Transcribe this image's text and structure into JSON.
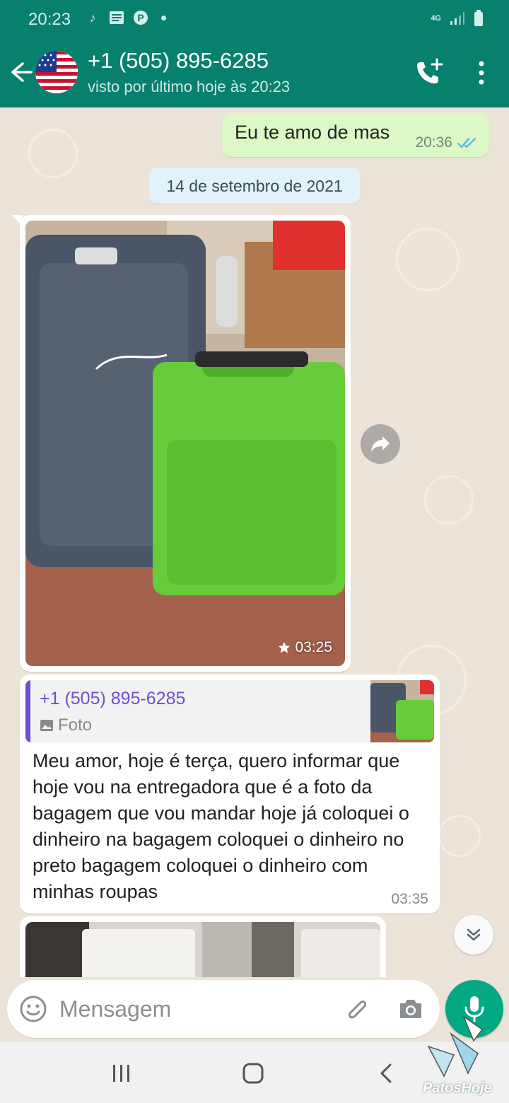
{
  "status_bar": {
    "time": "20:23",
    "network": "4G",
    "icons": [
      "tiktok-icon",
      "news-app-icon",
      "pinterest-icon",
      "notification-dot-icon",
      "signal-icon",
      "battery-icon"
    ]
  },
  "header": {
    "contact_name": "+1 (505) 895-6285",
    "contact_status": "visto por último hoje às 20:23",
    "avatar": "us-flag-avatar"
  },
  "messages": {
    "outgoing": {
      "text": "Eu te amo de mas",
      "time": "20:36",
      "status": "read"
    },
    "date_separator": "14 de setembro de 2021",
    "photo": {
      "time": "03:25",
      "starred": true,
      "description_icon": "photo-suitcases"
    },
    "reply": {
      "quoted_sender": "+1 (505) 895-6285",
      "quoted_type": "Foto",
      "text": "Meu amor, hoje é terça, quero informar que hoje vou na entregadora que é a foto da bagagem que vou mandar hoje já coloquei o dinheiro na bagagem coloquei o dinheiro no preto  bagagem coloquei o dinheiro com minhas roupas",
      "time": "03:35"
    }
  },
  "composer": {
    "placeholder": "Mensagem"
  },
  "watermark": "PatosHoje",
  "colors": {
    "header_green": "#08806e",
    "outgoing_bubble": "#dcf8c6",
    "chat_bg": "#ede4d9",
    "mic_button": "#03a884",
    "quote_accent": "#6e4fd1",
    "read_tick": "#4fb6ec"
  }
}
